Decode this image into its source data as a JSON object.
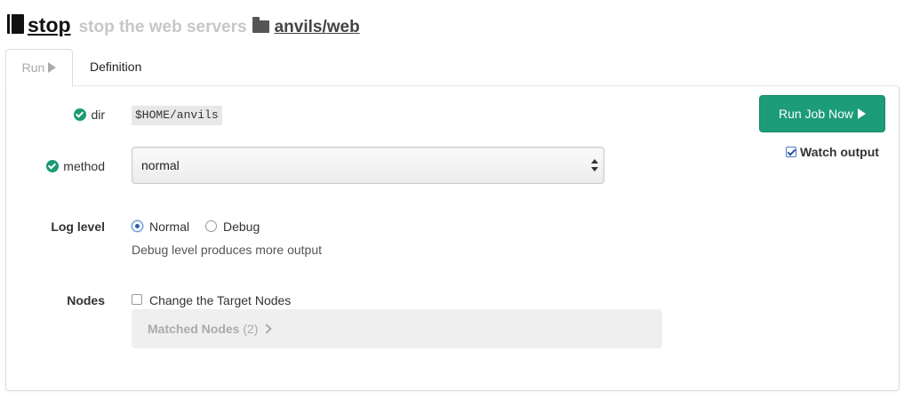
{
  "header": {
    "job_name": "stop",
    "job_description": "stop the web servers",
    "group_path": "anvils/web",
    "job_icon": "book-icon",
    "group_icon": "folder-icon"
  },
  "tabs": [
    {
      "label": "Run",
      "icon": "play-icon",
      "active": true
    },
    {
      "label": "Definition",
      "active": false
    }
  ],
  "options": {
    "dir": {
      "label": "dir",
      "value": "$HOME/anvils",
      "valid_icon": "check-circle-icon"
    },
    "method": {
      "label": "method",
      "selected": "normal",
      "valid_icon": "check-circle-icon"
    }
  },
  "log_level": {
    "label": "Log level",
    "choices": [
      {
        "label": "Normal",
        "checked": true
      },
      {
        "label": "Debug",
        "checked": false
      }
    ],
    "help": "Debug level produces more output"
  },
  "nodes": {
    "label": "Nodes",
    "change_target_label": "Change the Target Nodes",
    "change_target_checked": false,
    "matched_label": "Matched Nodes",
    "matched_count": "(2)"
  },
  "actions": {
    "run_label": "Run Job Now",
    "watch_output_label": "Watch output",
    "watch_output_checked": true
  },
  "colors": {
    "accent": "#1c9c78",
    "valid": "#1a9a74"
  }
}
